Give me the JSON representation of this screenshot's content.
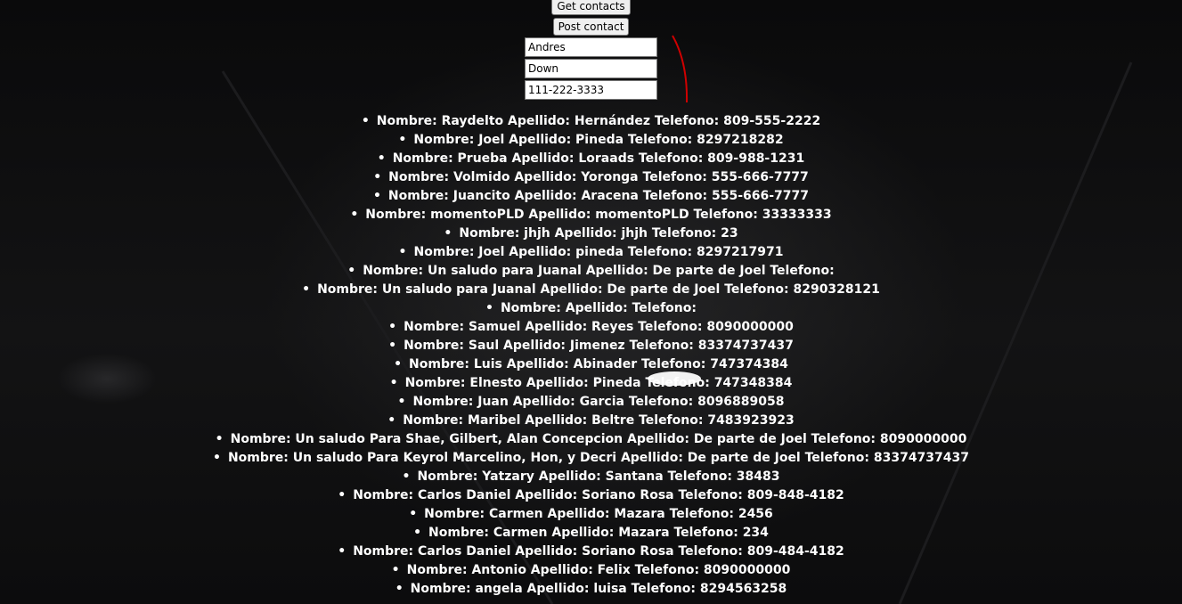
{
  "buttons": {
    "get_contacts": "Get contacts",
    "post_contact": "Post contact"
  },
  "form": {
    "nombre_value": "Andres",
    "apellido_value": "Down",
    "telefono_value": "111-222-3333"
  },
  "contacts": [
    "Nombre: Raydelto Apellido: Hernández Telefono: 809-555-2222",
    "Nombre: Joel Apellido: Pineda Telefono: 8297218282",
    "Nombre: Prueba Apellido: Loraads Telefono: 809-988-1231",
    "Nombre: Volmido Apellido: Yoronga Telefono: 555-666-7777",
    "Nombre: Juancito Apellido: Aracena Telefono: 555-666-7777",
    "Nombre: momentoPLD Apellido: momentoPLD Telefono: 33333333",
    "Nombre: jhjh Apellido: jhjh Telefono: 23",
    "Nombre: Joel Apellido: pineda Telefono: 8297217971",
    "Nombre: Un saludo para Juanal Apellido: De parte de Joel Telefono:",
    "Nombre: Un saludo para Juanal Apellido: De parte de Joel Telefono: 8290328121",
    "Nombre: Apellido: Telefono:",
    "Nombre: Samuel Apellido: Reyes Telefono: 8090000000",
    "Nombre: Saul Apellido: Jimenez Telefono: 83374737437",
    "Nombre: Luis Apellido: Abinader Telefono: 747374384",
    "Nombre: Elnesto Apellido: Pineda Telefono: 747348384",
    "Nombre: Juan Apellido: Garcia Telefono: 8096889058",
    "Nombre: Maribel Apellido: Beltre Telefono: 7483923923",
    "Nombre: Un saludo Para Shae, Gilbert, Alan Concepcion Apellido: De parte de Joel Telefono: 8090000000",
    "Nombre: Un saludo Para Keyrol Marcelino, Hon, y Decri Apellido: De parte de Joel Telefono: 83374737437",
    "Nombre: Yatzary Apellido: Santana Telefono: 38483",
    "Nombre: Carlos Daniel Apellido: Soriano Rosa Telefono: 809-848-4182",
    "Nombre: Carmen Apellido: Mazara Telefono: 2456",
    "Nombre: Carmen Apellido: Mazara Telefono: 234",
    "Nombre: Carlos Daniel Apellido: Soriano Rosa Telefono: 809-484-4182",
    "Nombre: Antonio Apellido: Felix Telefono: 8090000000",
    "Nombre: angela Apellido: luisa Telefono: 8294563258"
  ]
}
